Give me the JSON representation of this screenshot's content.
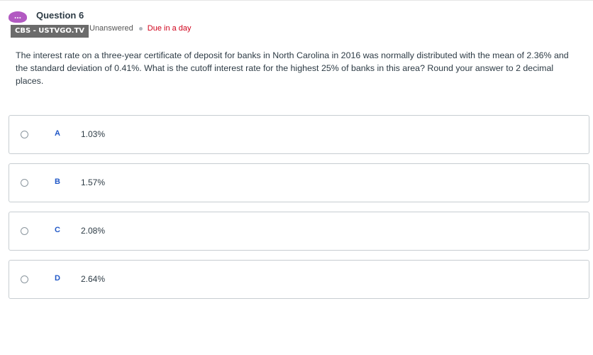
{
  "header": {
    "avatar_glyph": "...",
    "question_title": "Question 6",
    "overlay_tag": "CBS - USTVGO.TV",
    "status": "Unanswered",
    "due": "Due in a day"
  },
  "question": {
    "text": "The interest rate on a three-year certificate of deposit for banks in North Carolina in 2016 was normally distributed with the mean of 2.36% and the standard deviation of 0.41%. What is the cutoff interest rate for the highest 25% of banks in this area? Round your answer to 2 decimal places."
  },
  "options": [
    {
      "letter": "A",
      "value": "1.03%"
    },
    {
      "letter": "B",
      "value": "1.57%"
    },
    {
      "letter": "C",
      "value": "2.08%"
    },
    {
      "letter": "D",
      "value": "2.64%"
    }
  ],
  "colors": {
    "accent_letter": "#2158c7",
    "due": "#d0021b",
    "avatar": "#b25ac2"
  }
}
